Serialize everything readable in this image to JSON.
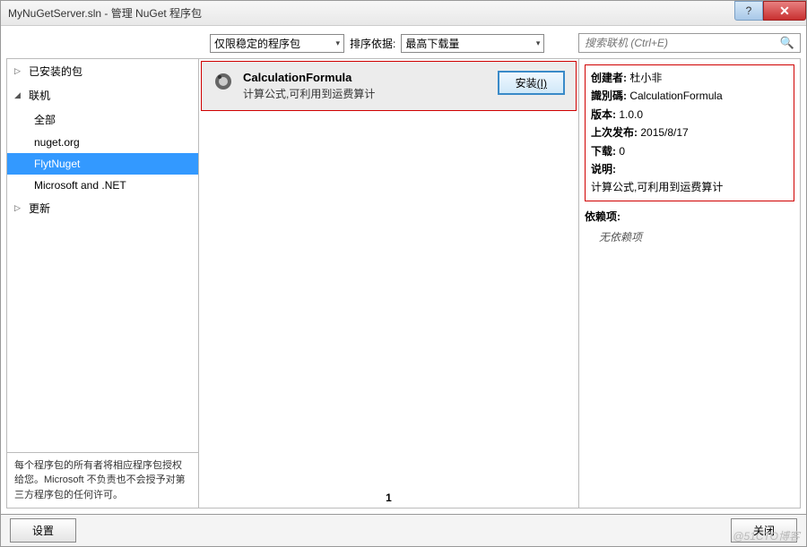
{
  "titlebar": {
    "text": "MyNuGetServer.sln - 管理 NuGet 程序包"
  },
  "toolbar": {
    "stable_only": "仅限稳定的程序包",
    "sort_label": "排序依据:",
    "sort_value": "最高下载量",
    "search_placeholder": "搜索联机 (Ctrl+E)"
  },
  "sidebar": {
    "items": [
      {
        "label": "已安装的包",
        "arrow": "▷",
        "top": true
      },
      {
        "label": "联机",
        "arrow": "◢",
        "top": true
      },
      {
        "label": "全部",
        "sub": true
      },
      {
        "label": "nuget.org",
        "sub": true
      },
      {
        "label": "FlytNuget",
        "sub": true,
        "selected": true
      },
      {
        "label": "Microsoft and .NET",
        "sub": true
      },
      {
        "label": "更新",
        "arrow": "▷",
        "top": true
      }
    ],
    "footer": "每个程序包的所有者将相应程序包授权给您。Microsoft 不负责也不会授予对第三方程序包的任何许可。"
  },
  "package": {
    "name": "CalculationFormula",
    "desc": "计算公式,可利用到运费算计",
    "install": "安装",
    "install_key": "(I)"
  },
  "pagination": {
    "current": "1"
  },
  "details": {
    "creator_label": "创建者:",
    "creator": "杜小非",
    "id_label": "識別碼:",
    "id": "CalculationFormula",
    "version_label": "版本:",
    "version": "1.0.0",
    "published_label": "上次发布:",
    "published": "2015/8/17",
    "downloads_label": "下载:",
    "downloads": "0",
    "desc_label": "说明:",
    "desc": "计算公式,可利用到运费算计",
    "deps_label": "依赖项:",
    "deps_none": "无依赖项"
  },
  "bottom": {
    "settings": "设置",
    "close": "关闭"
  },
  "watermark": "@51CTO博客"
}
